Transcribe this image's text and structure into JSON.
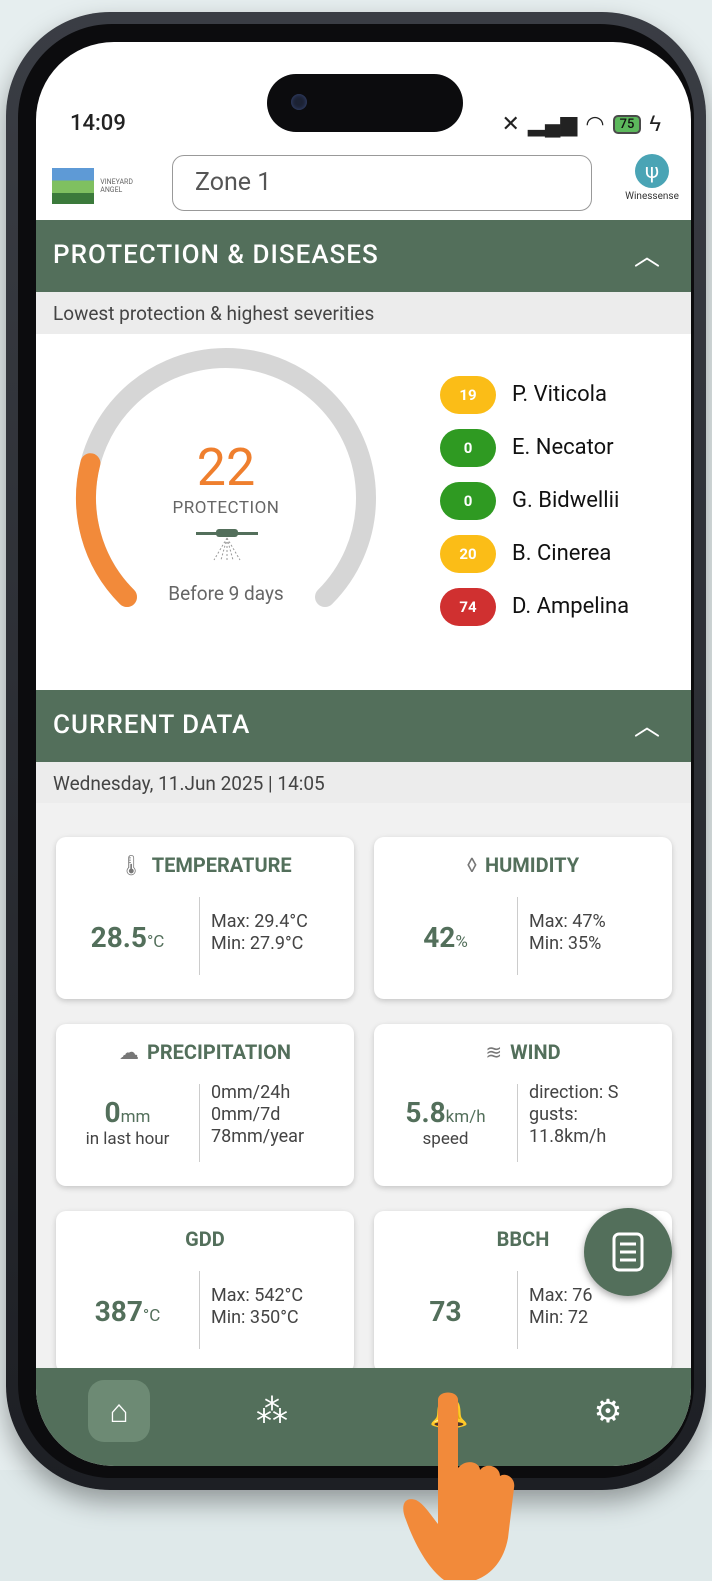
{
  "status": {
    "time": "14:09",
    "battery": "75"
  },
  "header": {
    "zone_value": "Zone 1",
    "brand": "Winessense",
    "logo_text": "VINEYARD ANGEL"
  },
  "protection": {
    "title": "PROTECTION & DISEASES",
    "subtitle": "Lowest protection & highest severities",
    "value": "22",
    "value_fraction": 0.22,
    "label": "PROTECTION",
    "last_treatment": "Before 9 days",
    "diseases": [
      {
        "score": "19",
        "name": "P. Viticola",
        "color": "#fbbd17"
      },
      {
        "score": "0",
        "name": "E. Necator",
        "color": "#2f9a22"
      },
      {
        "score": "0",
        "name": "G. Bidwellii",
        "color": "#2f9a22"
      },
      {
        "score": "20",
        "name": "B. Cinerea",
        "color": "#fbbd17"
      },
      {
        "score": "74",
        "name": "D. Ampelina",
        "color": "#d03030"
      }
    ]
  },
  "current": {
    "title": "CURRENT DATA",
    "datetime": "Wednesday, 11.Jun 2025 | 14:05",
    "temperature": {
      "title": "TEMPERATURE",
      "value": "28.5",
      "unit": "°C",
      "max": "Max: 29.4°C",
      "min": "Min: 27.9°C"
    },
    "humidity": {
      "title": "HUMIDITY",
      "value": "42",
      "unit": "%",
      "max": "Max: 47%",
      "min": "Min: 35%"
    },
    "precipitation": {
      "title": "PRECIPITATION",
      "value": "0",
      "unit": "mm",
      "sub": "in last hour",
      "day": "0mm/24h",
      "week": "0mm/7d",
      "year": "78mm/year"
    },
    "wind": {
      "title": "WIND",
      "value": "5.8",
      "unit": "km/h",
      "sub": "speed",
      "direction": "direction: S",
      "gusts1": "gusts:",
      "gusts2": "11.8km/h"
    },
    "gdd": {
      "title": "GDD",
      "value": "387",
      "unit": "°C",
      "max": "Max: 542°C",
      "min": "Min: 350°C"
    },
    "bbch": {
      "title": "BBCH",
      "value": "73",
      "max": "Max: 76",
      "min": "Min: 72"
    }
  }
}
